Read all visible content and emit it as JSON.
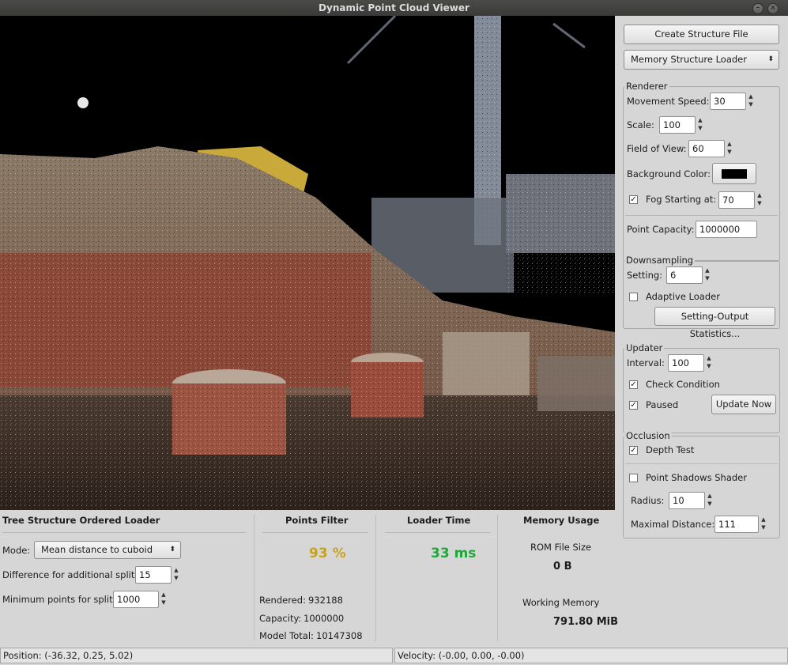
{
  "window": {
    "title": "Dynamic Point Cloud Viewer"
  },
  "right": {
    "create_button": "Create Structure File",
    "loader_select": "Memory Structure Loader",
    "renderer": {
      "title": "Renderer",
      "movement_label": "Movement Speed:",
      "movement_value": "30",
      "scale_label": "Scale:",
      "scale_value": "100",
      "fov_label": "Field of View:",
      "fov_value": "60",
      "bg_label": "Background Color:",
      "bg_color": "#000000",
      "fog_label": "Fog Starting at:",
      "fog_value": "70",
      "fog_checked": true,
      "capacity_label": "Point Capacity:",
      "capacity_value": "1000000"
    },
    "downsampling": {
      "title": "Downsampling",
      "setting_label": "Setting:",
      "setting_value": "6",
      "adaptive_label": "Adaptive Loader",
      "adaptive_checked": false,
      "stats_button": "Setting-Output Statistics..."
    },
    "updater": {
      "title": "Updater",
      "interval_label": "Interval:",
      "interval_value": "100",
      "check_label": "Check Condition",
      "check_checked": true,
      "paused_label": "Paused",
      "paused_checked": true,
      "update_button": "Update Now"
    },
    "occlusion": {
      "title": "Occlusion",
      "depth_label": "Depth Test",
      "depth_checked": true,
      "shadows_label": "Point Shadows Shader",
      "shadows_checked": false,
      "radius_label": "Radius:",
      "radius_value": "10",
      "maxdist_label": "Maximal Distance:",
      "maxdist_value": "111"
    }
  },
  "bottom": {
    "tree": {
      "title": "Tree Structure Ordered Loader",
      "mode_label": "Mode:",
      "mode_value": "Mean distance to cuboid",
      "diff_label": "Difference for additional split:",
      "diff_value": "15",
      "minpts_label": "Minimum points for split:",
      "minpts_value": "1000"
    },
    "filter": {
      "title": "Points Filter",
      "percent": "93 %",
      "percent_color": "#c8a21c",
      "rendered_label": "Rendered:",
      "rendered_value": "932188",
      "capacity_label": "Capacity:",
      "capacity_value": "1000000",
      "total_label": "Model Total:",
      "total_value": "10147308"
    },
    "loader": {
      "title": "Loader Time",
      "time": "33 ms",
      "time_color": "#21a63a"
    },
    "memory": {
      "title": "Memory Usage",
      "rom_label": "ROM File Size",
      "rom_value": "0 B",
      "working_label": "Working Memory",
      "working_value": "791.80 MiB"
    }
  },
  "status": {
    "position": "Position: (-36.32, 0.25, 5.02)",
    "velocity": "Velocity: (-0.00, 0.00, -0.00)"
  }
}
